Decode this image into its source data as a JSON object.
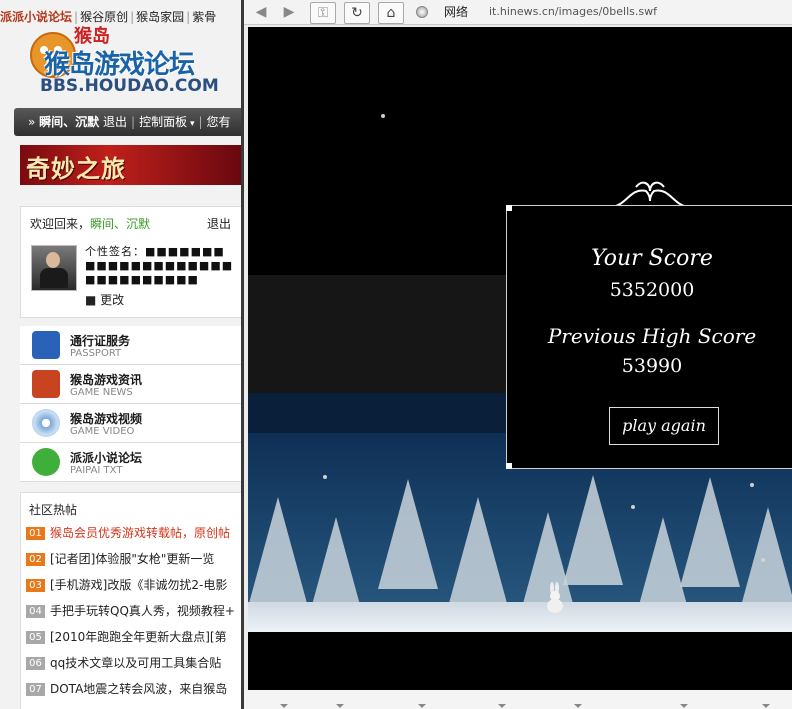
{
  "sidebar": {
    "topnav": [
      "派派小说论坛",
      "猴谷原创",
      "猴岛家园",
      "紫骨"
    ],
    "logo": {
      "mascot_text": "猴岛",
      "title": "猴岛游戏论坛",
      "url": "BBS.HOUDAO.COM"
    },
    "userbar": {
      "username": "瞬间、沉默",
      "logout": "退出",
      "control_panel": "控制面板",
      "more": "您有"
    },
    "banner_text": "奇妙之旅",
    "welcome": {
      "greeting": "欢迎回来，",
      "username": "瞬间、沉默",
      "logout": "退出",
      "signature_label": "个性签名：",
      "signature_blocks": "■■■■■■■■■■■■■■■■■■■■■■■■■■■■■■",
      "edit": "■ 更改"
    },
    "services": [
      {
        "title": "通行证服务",
        "subtitle": "PASSPORT",
        "icon": "passport-icon",
        "color": "#2a62b8"
      },
      {
        "title": "猴岛游戏资讯",
        "subtitle": "GAME NEWS",
        "icon": "news-icon",
        "color": "#c8431f"
      },
      {
        "title": "猴岛游戏视频",
        "subtitle": "GAME VIDEO",
        "icon": "dvd-icon",
        "color": "#7aa7d9"
      },
      {
        "title": "派派小说论坛",
        "subtitle": "PAIPAI TXT",
        "icon": "chat-bubble-icon",
        "color": "#3fae3a"
      }
    ],
    "hot": {
      "title": "社区热帖",
      "items": [
        {
          "num": "01",
          "text": "猴岛会员优秀游戏转载帖，原创帖",
          "highlight": true
        },
        {
          "num": "02",
          "text": "[记者团]体验服\"女枪\"更新一览",
          "highlight": true
        },
        {
          "num": "03",
          "text": "[手机游戏]改版《非诚勿扰2-电影",
          "highlight": true
        },
        {
          "num": "04",
          "text": "手把手玩转QQ真人秀，视频教程+",
          "highlight": false
        },
        {
          "num": "05",
          "text": "[2010年跑跑全年更新大盘点][第",
          "highlight": false
        },
        {
          "num": "06",
          "text": "qq技术文章以及可用工具集合贴",
          "highlight": false
        },
        {
          "num": "07",
          "text": "DOTA地震之转会风波，来自猴岛",
          "highlight": false
        }
      ]
    }
  },
  "browser": {
    "toolbar": {
      "back_icon": "back-arrow-icon",
      "forward_icon": "forward-arrow-icon",
      "key_icon": "key-icon",
      "refresh_icon": "refresh-icon",
      "home_icon": "home-icon",
      "network_label": "网络",
      "url": "it.hinews.cn/images/0bells.swf"
    },
    "game": {
      "score_label": "Your Score",
      "score": "5352000",
      "high_score_label": "Previous High Score",
      "high_score": "53990",
      "play_again": "play again"
    }
  }
}
